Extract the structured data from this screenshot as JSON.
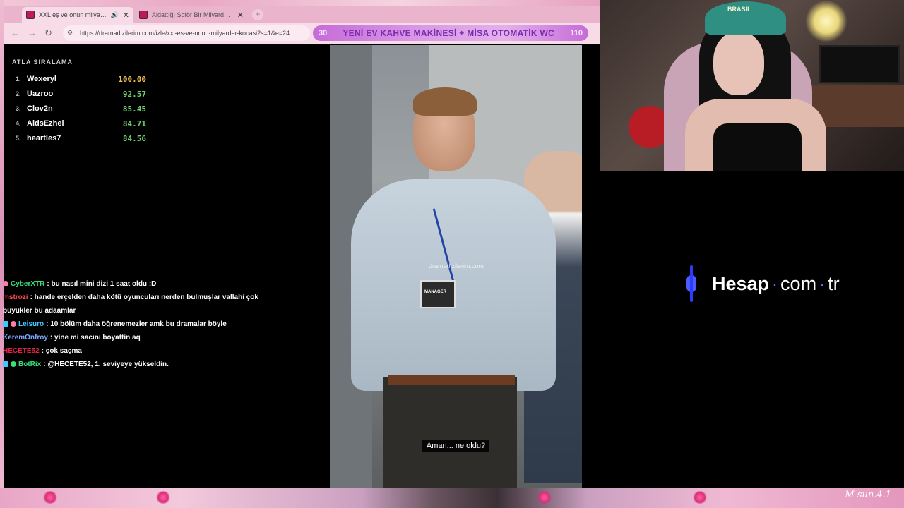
{
  "browser": {
    "tabs": [
      {
        "title": "XXL eş ve onun milyarder koc",
        "active": true,
        "speaker": "🔊",
        "close": "✕"
      },
      {
        "title": "Aldattığı Şoför Bir Milyarderdi",
        "active": false,
        "close": "✕"
      }
    ],
    "new_tab": "+",
    "nav": {
      "back": "←",
      "forward": "→",
      "reload": "↻"
    },
    "url": "https://dramadizilerim.com/izle/xxl-es-ve-onun-milyarder-kocasi?s=1&e=24",
    "site_icon": "⚙"
  },
  "ad_banner": {
    "left_num": "30",
    "text": "YENİ EV KAHVE MAKİNESİ + MİSA OTOMATİK WC",
    "right_num": "110"
  },
  "leaderboard": {
    "title": "ATLA SIRALAMA",
    "rows": [
      {
        "rank": "1.",
        "name": "Wexeryl",
        "score": "100.00"
      },
      {
        "rank": "2.",
        "name": "Uazroo",
        "score": "92.57"
      },
      {
        "rank": "3.",
        "name": "Clov2n",
        "score": "85.45"
      },
      {
        "rank": "4.",
        "name": "AidsEzhel",
        "score": "84.71"
      },
      {
        "rank": "5.",
        "name": "heartles7",
        "score": "84.56"
      }
    ]
  },
  "chat": [
    {
      "user": "CyberXTR",
      "color": "#38e07a",
      "msg": ": bu nasıl mini dizi 1 saat oldu :D"
    },
    {
      "user": "mstrozi",
      "color": "#ff4a4a",
      "msg": ": hande erçelden daha kötü oyuncuları nerden bulmuşlar vallahi çok büyükler bu adaamlar"
    },
    {
      "user": "Leisuro",
      "color": "#37c9ff",
      "msg": ": 10 bölüm daha öğrenemezler amk bu dramalar böyle"
    },
    {
      "user": "KeremOnfroy",
      "color": "#7aa7ff",
      "msg": ": yine mi sacını boyattin aq"
    },
    {
      "user": "HECETE52",
      "color": "#e0224a",
      "msg": ": çok saçma"
    },
    {
      "user": "BotRix",
      "color": "#38e07a",
      "msg": ": @HECETE52, 1. seviyeye yükseldin."
    }
  ],
  "video": {
    "watermark": "dramadizilerim.com",
    "badge_text": "MANAGER",
    "subtitle": "Aman... ne oldu?"
  },
  "webcam": {
    "hat_text": "BRASIL"
  },
  "sponsor": {
    "brand": "Hesap",
    "dot": "·",
    "com": "com",
    "dot2": "·",
    "tld": "tr"
  },
  "overlay": {
    "signature": "M sun.4.1"
  },
  "colors": {
    "accent_pink": "#e9a8c4",
    "score_green": "#6dd36d",
    "score_gold": "#f2c14e",
    "sponsor_blue": "#2a3cff"
  }
}
